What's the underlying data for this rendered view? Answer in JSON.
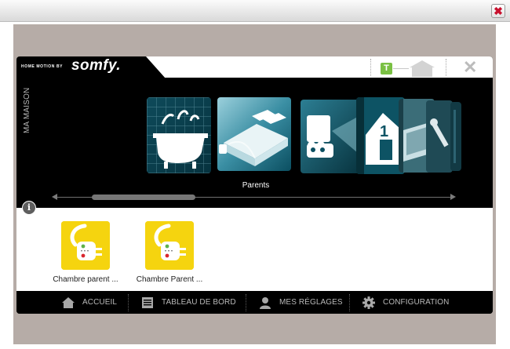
{
  "window": {
    "close_glyph": "✖"
  },
  "app": {
    "brand_small": "HOME MOTION BY",
    "brand_name": "somfy.",
    "touch_badge": "T",
    "close_glyph": "✕"
  },
  "carousel": {
    "side_label": "MA MAISON",
    "selected_label": "Parents",
    "tiles": [
      {
        "name": "bathroom",
        "icon": "bathtub-icon"
      },
      {
        "name": "parents-bedroom",
        "icon": "bed-icon"
      },
      {
        "name": "video",
        "icon": "projector-icon"
      },
      {
        "name": "house",
        "icon": "house-icon"
      },
      {
        "name": "room",
        "icon": "box-icon"
      }
    ],
    "scroll_position": 0.12
  },
  "devices": [
    {
      "label": "Chambre parent ...",
      "icon": "plug-icon"
    },
    {
      "label": "Chambre Parent ...",
      "icon": "plug-icon"
    }
  ],
  "nav": [
    {
      "label": "ACCUEIL",
      "icon": "home-icon"
    },
    {
      "label": "TABLEAU DE BORD",
      "icon": "dashboard-icon"
    },
    {
      "label": "MES RÉGLAGES",
      "icon": "user-icon"
    },
    {
      "label": "CONFIGURATION",
      "icon": "gear-icon"
    }
  ],
  "colors": {
    "frame": "#b6aca7",
    "device_yellow": "#f5d40f",
    "touch_green": "#7ac043",
    "window_close_red": "#c8102e"
  }
}
